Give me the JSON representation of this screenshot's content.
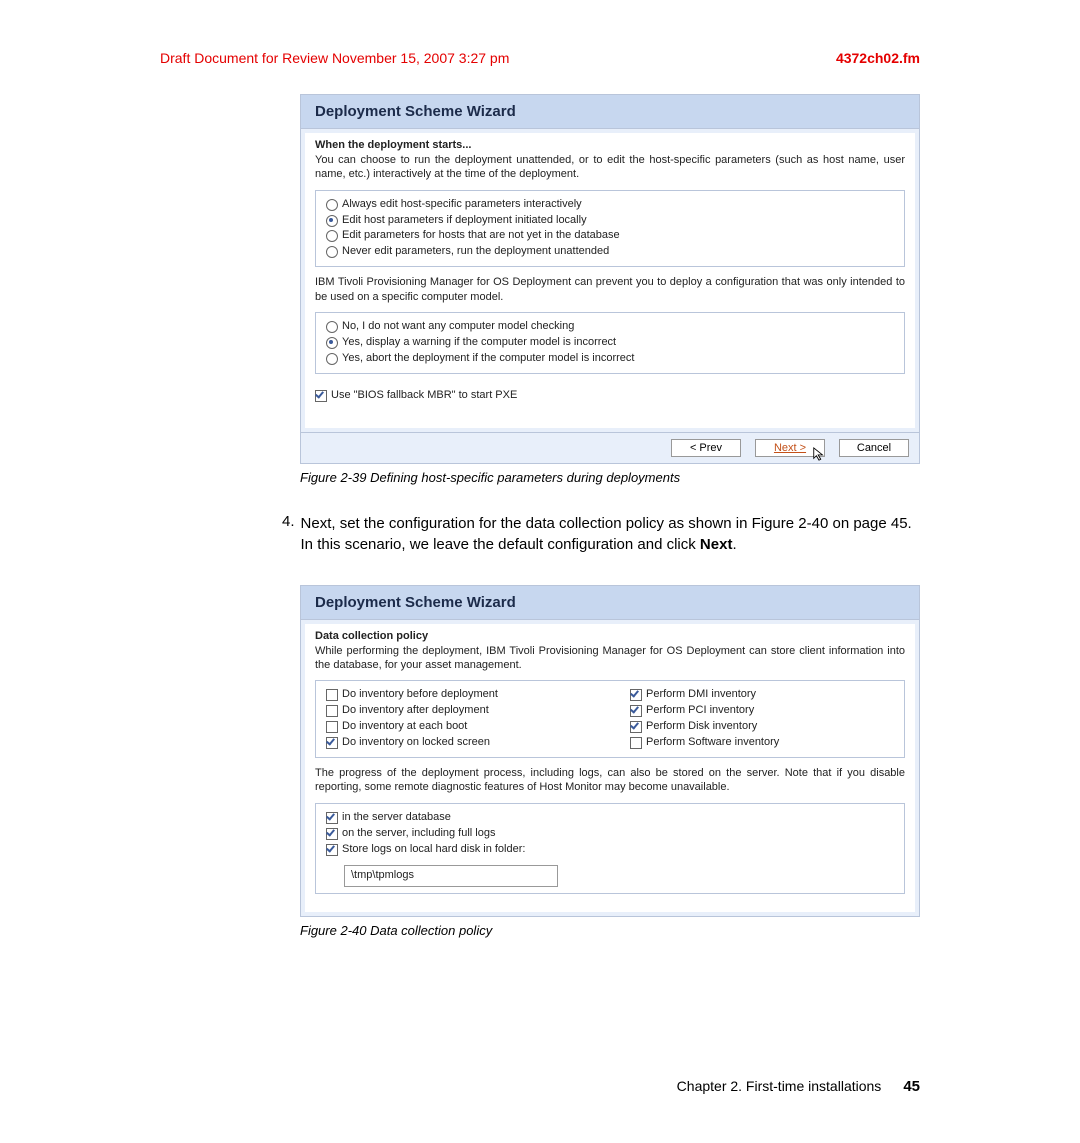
{
  "header": {
    "draft": "Draft Document for Review November 15, 2007 3:27 pm",
    "filename": "4372ch02.fm"
  },
  "wizard1": {
    "title": "Deployment Scheme Wizard",
    "heading": "When the deployment starts...",
    "intro": "You can choose to run the deployment unattended, or to edit the host-specific parameters (such as host name, user name, etc.) interactively at the time of the deployment.",
    "opts1": [
      {
        "label": "Always edit host-specific parameters interactively",
        "selected": false
      },
      {
        "label": "Edit host parameters if deployment initiated locally",
        "selected": true
      },
      {
        "label": "Edit parameters for hosts that are not yet in the database",
        "selected": false
      },
      {
        "label": "Never edit parameters, run the deployment unattended",
        "selected": false
      }
    ],
    "modelCheckText": "IBM Tivoli Provisioning Manager for OS Deployment can prevent you to deploy a configuration that was only intended to be used on a specific computer model.",
    "opts2": [
      {
        "label": "No, I do not want any computer model checking",
        "selected": false
      },
      {
        "label": "Yes, display a warning if the computer model is incorrect",
        "selected": true
      },
      {
        "label": "Yes, abort the deployment if the computer model is incorrect",
        "selected": false
      }
    ],
    "biosCheck": {
      "label": "Use \"BIOS fallback MBR\" to start PXE",
      "checked": true
    },
    "buttons": {
      "prev": "< Prev",
      "next": "Next >",
      "cancel": "Cancel"
    }
  },
  "caption1": "Figure 2-39   Defining host-specific parameters during deployments",
  "step4": {
    "num": "4.",
    "text_a": "Next, set the configuration for the data collection policy as shown in Figure 2-40 on page 45. In this scenario, we leave the default configuration and click ",
    "text_b": "Next",
    "text_c": "."
  },
  "wizard2": {
    "title": "Deployment Scheme Wizard",
    "heading": "Data collection policy",
    "intro": "While performing the deployment, IBM Tivoli Provisioning Manager for OS Deployment can store client information into the database, for your asset management.",
    "leftChecks": [
      {
        "label": "Do inventory before deployment",
        "checked": false
      },
      {
        "label": "Do inventory after deployment",
        "checked": false
      },
      {
        "label": "Do inventory at each boot",
        "checked": false
      },
      {
        "label": "Do inventory on locked screen",
        "checked": true
      }
    ],
    "rightChecks": [
      {
        "label": "Perform DMI inventory",
        "checked": true
      },
      {
        "label": "Perform PCI inventory",
        "checked": true
      },
      {
        "label": "Perform Disk inventory",
        "checked": true
      },
      {
        "label": "Perform Software inventory",
        "checked": false
      }
    ],
    "progressText": "The progress of the deployment process, including logs, can also be stored on the server. Note that if you disable reporting, some remote diagnostic features of Host Monitor may become unavailable.",
    "storeChecks": [
      {
        "label": "in the server database",
        "checked": true
      },
      {
        "label": "on the server, including full logs",
        "checked": true
      },
      {
        "label": "Store logs on local hard disk in folder:",
        "checked": true
      }
    ],
    "logPath": "\\tmp\\tpmlogs"
  },
  "caption2": "Figure 2-40   Data collection policy",
  "footer": {
    "chapter": "Chapter 2. First-time installations",
    "page": "45"
  }
}
